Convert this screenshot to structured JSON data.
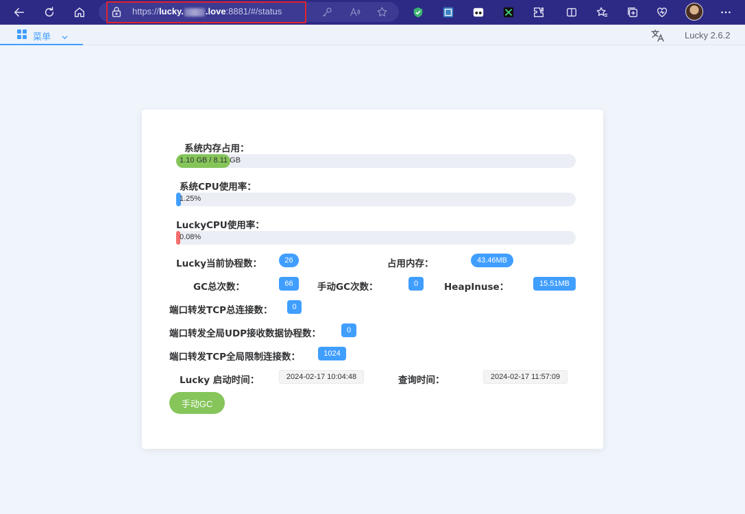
{
  "browser": {
    "url_prefix": "https://",
    "url_host_start": "lucky.",
    "url_host_end": ".love",
    "url_rest": ":8881/#/status"
  },
  "nav": {
    "menu_label": "菜单",
    "version": "Lucky 2.6.2"
  },
  "status": {
    "mem_label": "系统内存占用：",
    "mem_text": "1.10 GB / 8.11 GB",
    "mem_fraction": 0.1356,
    "cpu_label": "系统CPU使用率：",
    "cpu_text": "1.25%",
    "cpu_fraction": 0.0125,
    "lucky_cpu_label": "LuckyCPU使用率：",
    "lucky_cpu_text": "0.08%",
    "lucky_cpu_fraction": 0.0008,
    "goroutines_label": "Lucky当前协程数：",
    "goroutines_value": "26",
    "mem_used_label": "占用内存：",
    "mem_used_value": "43.46MB",
    "gc_total_label": "GC总次数：",
    "gc_total_value": "66",
    "manual_gc_count_label": "手动GC次数：",
    "manual_gc_count_value": "0",
    "heap_label": "HeapInuse：",
    "heap_value": "15.51MB",
    "tcp_total_label": "端口转发TCP总连接数：",
    "tcp_total_value": "0",
    "udp_label": "端口转发全局UDP接收数据协程数：",
    "udp_value": "0",
    "tcp_limit_label": "端口转发TCP全局限制连接数：",
    "tcp_limit_value": "1024",
    "start_time_label": "Lucky 启动时间：",
    "start_time_value": "2024-02-17 10:04:48",
    "query_time_label": "查询时间：",
    "query_time_value": "2024-02-17 11:57:09",
    "gc_button": "手动GC"
  },
  "colors": {
    "mem_fill": "#85c55a",
    "cpu_fill": "#409eff",
    "lucky_cpu_fill": "#f56c6c",
    "badge": "#409eff"
  },
  "icons": [
    "back-arrow-icon",
    "refresh-icon",
    "home-icon",
    "lock-icon",
    "key-icon",
    "read-aloud-icon",
    "favorite-star-icon",
    "shield-extension-icon",
    "blue-extension-icon",
    "video-extension-icon",
    "scissors-extension-icon",
    "extensions-puzzle-icon",
    "split-screen-icon",
    "favorites-icon",
    "collections-icon",
    "browser-essentials-icon",
    "profile-avatar",
    "more-icon",
    "menu-grid-icon",
    "chevron-down-icon",
    "translate-icon"
  ]
}
